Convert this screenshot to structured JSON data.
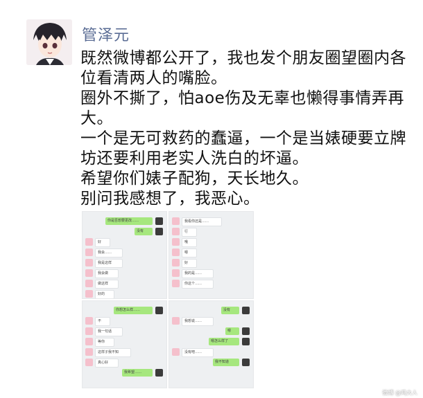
{
  "post": {
    "username": "管泽元",
    "lines": [
      "既然微博都公开了，我也发个朋友圈望圈内各",
      "位看清两人的嘴脸。",
      "圈外不撕了，怕aoe伤及无辜也懒得事情弄再",
      "大。",
      "一个是无可救药的蠢逼，一个是当婊硬要立牌",
      "坊还要利用老实人洗白的坏逼。",
      "希望你们婊子配狗，天长地久。",
      "别问我感想了，我恶心。"
    ]
  },
  "thumbnails": [
    {
      "name": "chat-screenshot-1",
      "messages": [
        {
          "side": "right",
          "text": "你是否想要更改……"
        },
        {
          "side": "right",
          "text": "没有"
        },
        {
          "side": "left",
          "text": "好"
        },
        {
          "side": "left",
          "text": "我会……"
        },
        {
          "side": "left",
          "text": "我是这样"
        },
        {
          "side": "left",
          "text": "我会做"
        },
        {
          "side": "left",
          "text": "做这样"
        },
        {
          "side": "left",
          "text": "好的"
        }
      ]
    },
    {
      "name": "chat-screenshot-2",
      "messages": [
        {
          "side": "left",
          "text": "我看你还是……"
        },
        {
          "side": "left",
          "text": "行"
        },
        {
          "side": "left",
          "text": "哦"
        },
        {
          "side": "left",
          "text": "嗯"
        },
        {
          "side": "left",
          "text": "好"
        },
        {
          "side": "left",
          "text": "我的是……"
        },
        {
          "side": "left",
          "text": "你这个……"
        }
      ]
    },
    {
      "name": "chat-screenshot-3",
      "messages": [
        {
          "side": "right",
          "text": "你想怎么样……"
        },
        {
          "side": "left",
          "text": "不"
        },
        {
          "side": "left",
          "text": "我一句话"
        },
        {
          "side": "left",
          "text": "等你"
        },
        {
          "side": "left",
          "text": "这样子我不知"
        },
        {
          "side": "left",
          "text": "真心好"
        },
        {
          "side": "right",
          "text": "我希望……"
        }
      ]
    },
    {
      "name": "chat-screenshot-4",
      "messages": [
        {
          "side": "right",
          "text": "没有"
        },
        {
          "side": "left",
          "text": "我想说……"
        },
        {
          "side": "right",
          "text": "嗯"
        },
        {
          "side": "right",
          "text": "嗯怎么样了"
        },
        {
          "side": "left",
          "text": "没有吧……"
        },
        {
          "side": "right",
          "text": "我不知道"
        }
      ]
    }
  ],
  "watermark": "微博 @鸡大人"
}
